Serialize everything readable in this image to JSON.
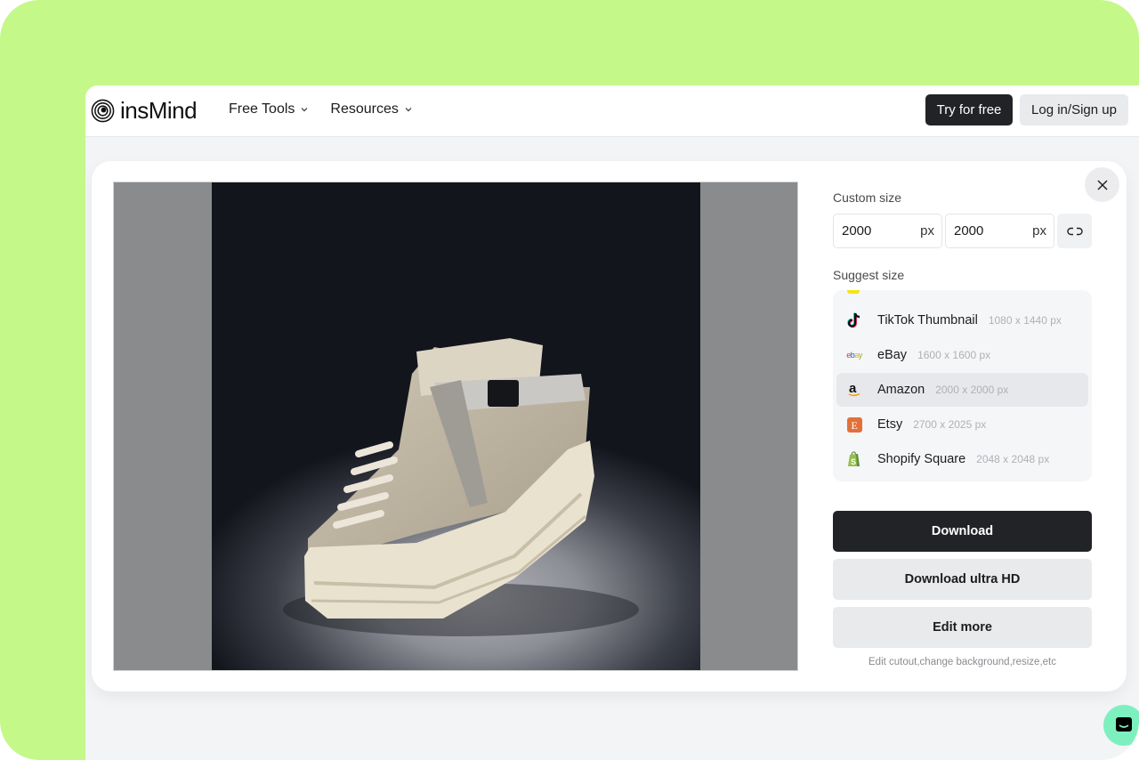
{
  "header": {
    "brand": "insMind",
    "nav": [
      {
        "label": "Free Tools"
      },
      {
        "label": "Resources"
      }
    ],
    "try_free": "Try for free",
    "login": "Log in/Sign up"
  },
  "modal": {
    "custom_size_label": "Custom size",
    "width_value": "2000",
    "height_value": "2000",
    "unit": "px",
    "suggest_size_label": "Suggest size",
    "suggestions": [
      {
        "name": "TikTok Thumbnail",
        "dims": "1080 x 1440 px",
        "icon": "tiktok-icon",
        "selected": false
      },
      {
        "name": "eBay",
        "dims": "1600 x 1600 px",
        "icon": "ebay-icon",
        "selected": false
      },
      {
        "name": "Amazon",
        "dims": "2000 x 2000 px",
        "icon": "amazon-icon",
        "selected": true
      },
      {
        "name": "Etsy",
        "dims": "2700 x 2025 px",
        "icon": "etsy-icon",
        "selected": false
      },
      {
        "name": "Shopify Square",
        "dims": "2048 x 2048 px",
        "icon": "shopify-icon",
        "selected": false
      }
    ],
    "download": "Download",
    "download_hd": "Download ultra HD",
    "edit_more": "Edit more",
    "hint": "Edit cutout,change background,resize,etc"
  },
  "colors": {
    "frame_bg": "#c4f888",
    "primary_btn": "#222326",
    "secondary_btn": "#e9eaec",
    "chat_bubble": "#7ef0bf",
    "etsy": "#e2703a",
    "shopify": "#5e8e3e"
  }
}
